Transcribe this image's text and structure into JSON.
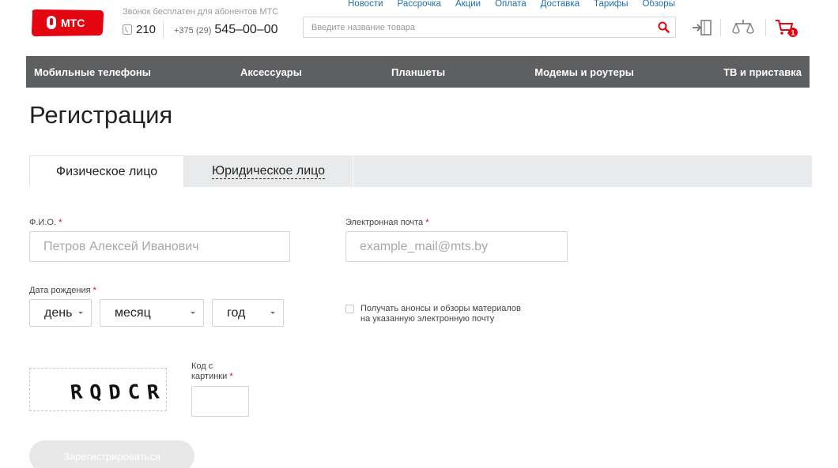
{
  "header": {
    "logo_text": "МТС",
    "hotline_text": "Звонок бесплатен для абонентов МТС",
    "short_number": "210",
    "phone_code": "+375 (29)",
    "phone_number": "545–00–00",
    "top_nav": [
      "Новости",
      "Рассрочка",
      "Акции",
      "Оплата",
      "Доставка",
      "Тарифы",
      "Обзоры"
    ],
    "search_placeholder": "Введите название товара",
    "cart_count": "1",
    "icons": [
      "login-icon",
      "compare-icon",
      "cart-icon"
    ]
  },
  "categories": [
    "Мобильные телефоны",
    "Аксессуары",
    "Планшеты",
    "Модемы и роутеры",
    "ТВ и приставка"
  ],
  "page_title": "Регистрация",
  "tabs": {
    "individual": "Физическое лицо",
    "legal": "Юридическое лицо"
  },
  "form": {
    "fio_label": "Ф.И.О.",
    "fio_placeholder": "Петров Алексей Иванович",
    "email_label": "Электронная почта",
    "email_placeholder": "example_mail@mts.by",
    "birth_label": "Дата рождения",
    "day": "день",
    "month": "месяц",
    "year": "год",
    "required_mark": "*",
    "subscribe_line1": "Получать анонсы и обзоры материалов",
    "subscribe_line2": "на указанную электронную почту",
    "captcha_text": "RQDCR",
    "captcha_label_line1": "Код с",
    "captcha_label_line2": "картинки",
    "submit_label": "Зарегистрироваться"
  },
  "colors": {
    "brand_red": "#e30611",
    "nav_blue": "#1f6fae",
    "category_bar": "#5e5f61"
  }
}
